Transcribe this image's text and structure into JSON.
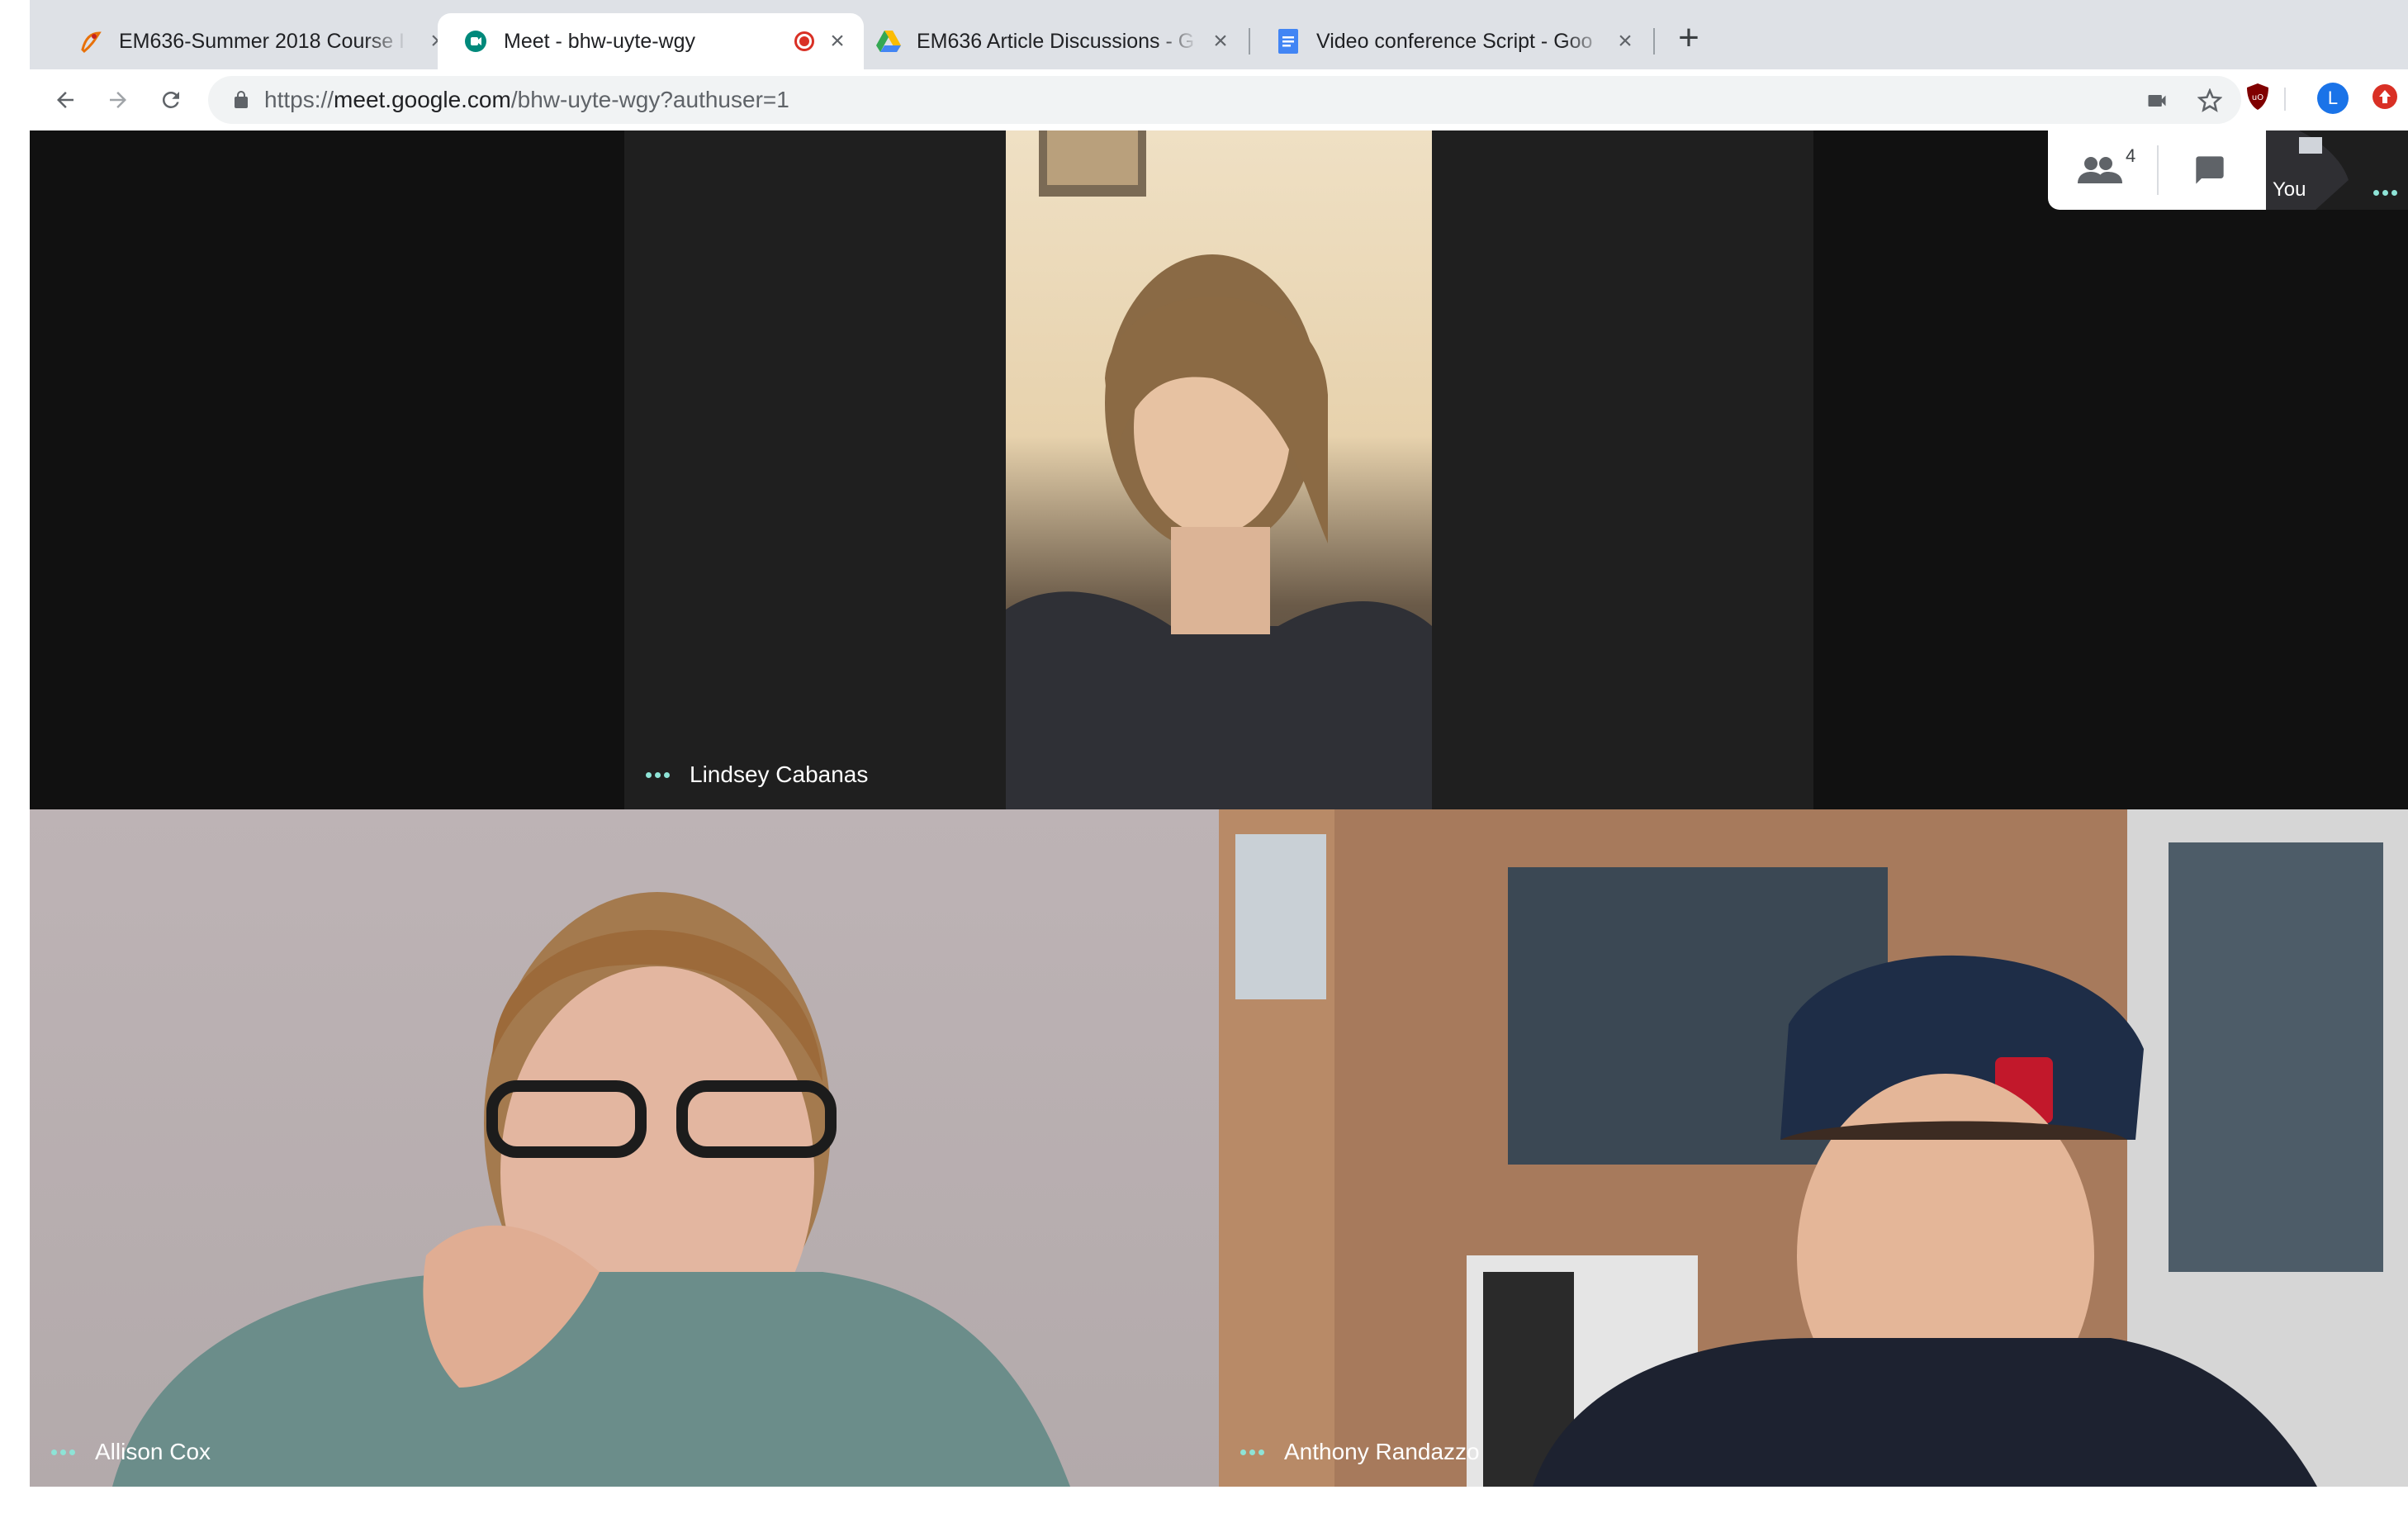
{
  "browser": {
    "tabs": [
      {
        "title": "EM636-Summer 2018 Course I",
        "favicon": "course-site-icon",
        "active": false
      },
      {
        "title": "Meet - bhw-uyte-wgy",
        "favicon": "google-meet-icon",
        "active": true,
        "recording": true
      },
      {
        "title": "EM636 Article Discussions - G",
        "favicon": "google-drive-icon",
        "active": false
      },
      {
        "title": "Video conference Script - Goo",
        "favicon": "google-docs-icon",
        "active": false
      }
    ],
    "new_tab_label": "+",
    "address": {
      "scheme": "https://",
      "host": "meet.google.com",
      "path": "/bhw-uyte-wgy?authuser=1"
    },
    "profile_initial": "L"
  },
  "meet": {
    "participant_count": "4",
    "self_label": "You",
    "participants": [
      {
        "name": "Lindsey Cabanas"
      },
      {
        "name": "Allison Cox"
      },
      {
        "name": "Anthony Randazzo"
      }
    ]
  },
  "colors": {
    "tabstrip_bg": "#dee1e6",
    "meet_bg": "#111111",
    "speaking_dots": "#8ee3d6",
    "record_red": "#d93025"
  }
}
